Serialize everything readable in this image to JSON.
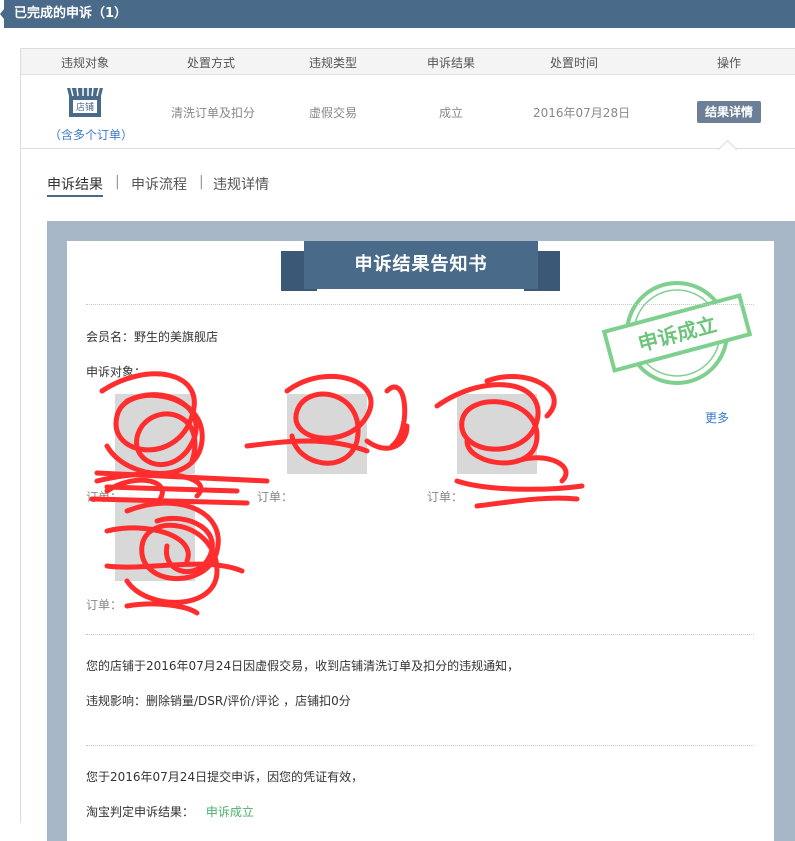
{
  "header": {
    "title": "已完成的申诉（1）"
  },
  "table": {
    "columns": [
      "违规对象",
      "处置方式",
      "违规类型",
      "申诉结果",
      "处置时间",
      "操作"
    ],
    "row": {
      "store_icon_text": "店铺",
      "multi_orders": "（含多个订单）",
      "handling": "清洗订单及扣分",
      "violation_type": "虚假交易",
      "appeal_result": "成立",
      "time": "2016年07月28日",
      "detail_button": "结果详情"
    }
  },
  "tabs": [
    {
      "label": "申诉结果",
      "active": true
    },
    {
      "label": "申诉流程",
      "active": false
    },
    {
      "label": "违规详情",
      "active": false
    }
  ],
  "notice": {
    "title": "申诉结果告知书",
    "stamp_text": "申诉成立",
    "member_line": "会员名：野生的美旗舰店",
    "appeal_object_label": "申诉对象：",
    "more_link": "更多",
    "order_labels": [
      "订单：",
      "订单：",
      "订单：",
      "订单："
    ],
    "violation_line": "您的店铺于2016年07月24日因虚假交易，收到店铺清洗订单及扣分的违规通知，",
    "impact_line": "违规影响：删除销量/DSR/评价/评论 ，店铺扣0分",
    "submit_line": "您于2016年07月24日提交申诉，因您的凭证有效，",
    "judge_label": "淘宝判定申诉结果：",
    "judge_result": "申诉成立"
  },
  "colors": {
    "accent": "#4a6a8a",
    "stamp_green": "#4caf6d",
    "scribble_red": "#ff2d2d",
    "link_blue": "#3a7bc8"
  },
  "icons": [
    "store-icon",
    "approved-stamp"
  ]
}
